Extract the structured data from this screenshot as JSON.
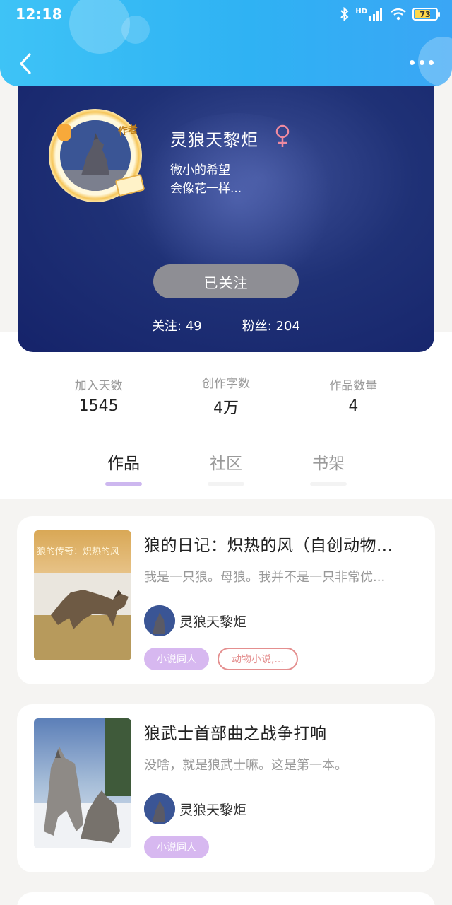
{
  "status_bar": {
    "time": "12:18",
    "network": "HD",
    "battery": "73",
    "battery_level": 0.73
  },
  "profile": {
    "name": "灵狼天黎炬",
    "badge": "作者",
    "bio_line1": "微小的希望",
    "bio_line2": "会像花一样...",
    "follow_label": "已关注",
    "following": "关注: 49",
    "followers": "粉丝: 204"
  },
  "stats": [
    {
      "label": "加入天数",
      "value": "1545"
    },
    {
      "label": "创作字数",
      "value": "4万"
    },
    {
      "label": "作品数量",
      "value": "4"
    }
  ],
  "tabs": [
    {
      "label": "作品",
      "active": true
    },
    {
      "label": "社区",
      "active": false
    },
    {
      "label": "书架",
      "active": false
    }
  ],
  "works": [
    {
      "title": "狼的日记：炽热的风（自创动物...",
      "cover_text": "狼的传奇：炽热的风",
      "desc": "我是一只狼。母狼。我并不是一只非常优...",
      "author": "灵狼天黎炬",
      "tags": [
        "小说同人",
        "动物小说,..."
      ]
    },
    {
      "title": "狼武士首部曲之战争打响",
      "desc": "没啥，就是狼武士嘛。这是第一本。",
      "author": "灵狼天黎炬",
      "tags": [
        "小说同人"
      ]
    }
  ],
  "colors": {
    "header": "#2fb2f3",
    "hero": "#1f3176",
    "accent_tag": "#d7b8f0",
    "outline_tag": "#e48f8f"
  }
}
